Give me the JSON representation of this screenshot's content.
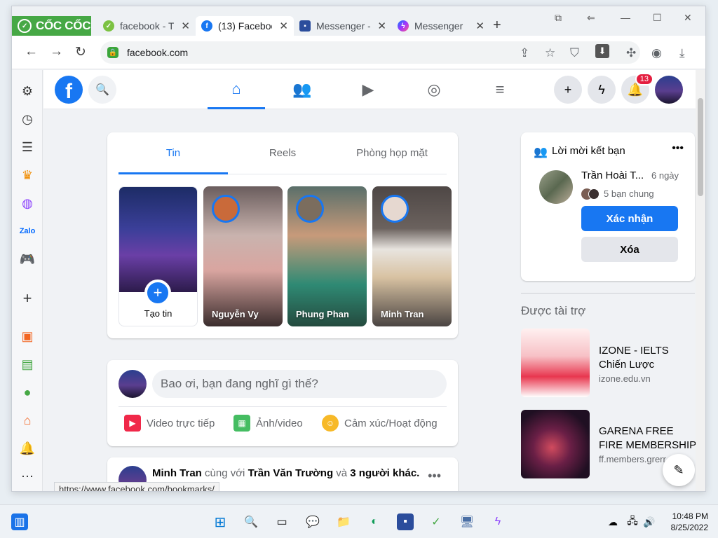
{
  "browser": {
    "brand": "CỐC CỐC",
    "tabs": [
      {
        "title": "facebook - T",
        "active": false
      },
      {
        "title": "(13) Faceboo",
        "active": true
      },
      {
        "title": "Messenger -",
        "active": false
      },
      {
        "title": "Messenger",
        "active": false
      }
    ],
    "url": "facebook.com",
    "status_url": "https://www.facebook.com/bookmarks/"
  },
  "fb": {
    "notification_count": "13",
    "story_tabs": [
      "Tin",
      "Reels",
      "Phòng họp mặt"
    ],
    "create_story_label": "Tạo tin",
    "stories": [
      {
        "name": "Nguyễn Vy"
      },
      {
        "name": "Phung Phan"
      },
      {
        "name": "Minh Tran"
      }
    ],
    "composer_placeholder": "Bao ơi, bạn đang nghĩ gì thế?",
    "composer_actions": [
      {
        "label": "Video trực tiếp",
        "color": "#f02849"
      },
      {
        "label": "Ảnh/video",
        "color": "#45bd62"
      },
      {
        "label": "Cảm xúc/Hoạt động",
        "color": "#f7b928"
      }
    ],
    "post": {
      "author": "Minh Tran",
      "with_text": "cùng với",
      "tagged": "Trần Văn Trường",
      "and_text": "và",
      "others": "3 người khác."
    },
    "friend_requests": {
      "title": "Lời mời kết bạn",
      "name": "Trần Hoài T...",
      "time": "6 ngày",
      "mutual": "5 bạn chung",
      "confirm": "Xác nhận",
      "delete": "Xóa"
    },
    "sponsored": {
      "title": "Được tài trợ",
      "ads": [
        {
          "title": "IZONE - IELTS Chiến Lược",
          "url": "izone.edu.vn"
        },
        {
          "title": "GARENA FREE FIRE MEMBERSHIP",
          "url": "ff.members.grerr"
        }
      ]
    }
  },
  "taskbar": {
    "time": "10:48 PM",
    "date": "8/25/2022"
  }
}
